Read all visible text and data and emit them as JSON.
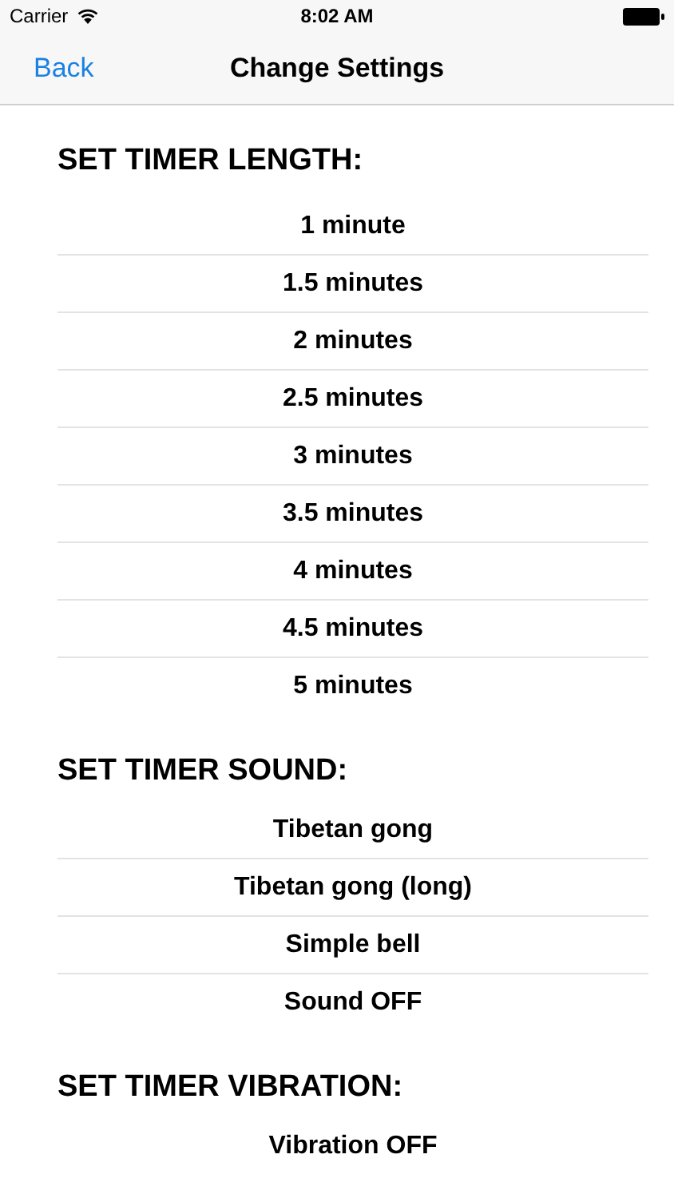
{
  "status_bar": {
    "carrier": "Carrier",
    "time": "8:02 AM"
  },
  "nav_bar": {
    "back": "Back",
    "title": "Change Settings"
  },
  "sections": [
    {
      "heading": "SET TIMER LENGTH:",
      "options": [
        "1 minute",
        "1.5 minutes",
        "2 minutes",
        "2.5 minutes",
        "3 minutes",
        "3.5 minutes",
        "4 minutes",
        "4.5 minutes",
        "5 minutes"
      ]
    },
    {
      "heading": "SET TIMER SOUND:",
      "options": [
        "Tibetan gong",
        "Tibetan gong (long)",
        "Simple bell",
        "Sound OFF"
      ]
    },
    {
      "heading": "SET TIMER VIBRATION:",
      "options": [
        "Vibration OFF"
      ]
    }
  ]
}
